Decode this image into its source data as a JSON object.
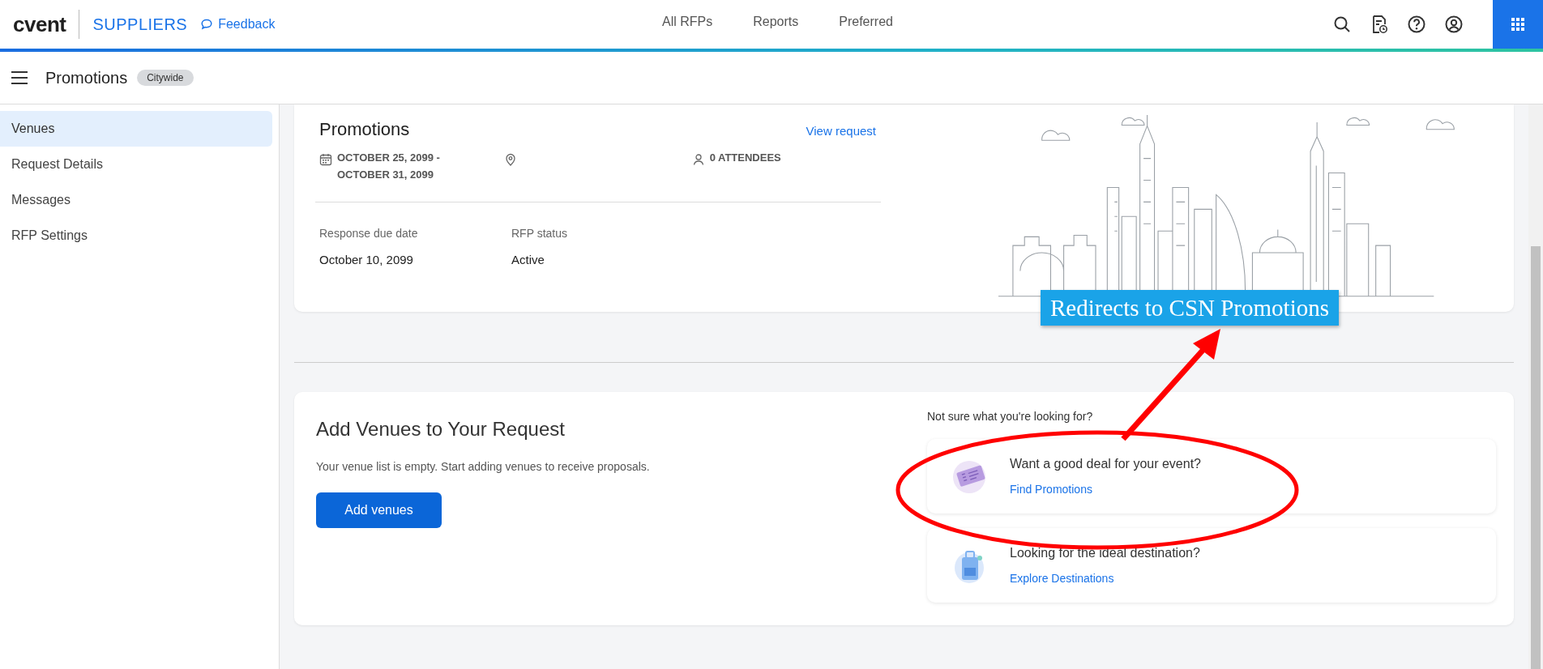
{
  "header": {
    "logo": "cvent",
    "product": "SUPPLIERS",
    "feedback": "Feedback",
    "nav": [
      {
        "label": "All RFPs",
        "selected": false
      },
      {
        "label": "Reports",
        "selected": false
      },
      {
        "label": "Preferred",
        "selected": false
      }
    ]
  },
  "subheader": {
    "title": "Promotions",
    "badge": "Citywide"
  },
  "sidebar": {
    "items": [
      {
        "label": "Venues",
        "selected": true
      },
      {
        "label": "Request Details",
        "selected": false
      },
      {
        "label": "Messages",
        "selected": false
      },
      {
        "label": "RFP Settings",
        "selected": false
      }
    ]
  },
  "summary": {
    "title": "Promotions",
    "link": "View request",
    "dates": [
      "OCTOBER 25, 2099 -",
      "OCTOBER 31, 2099"
    ],
    "attendees": "0 ATTENDEES",
    "fields": [
      {
        "label": "Response due date",
        "value": "October 10, 2099"
      },
      {
        "label": "RFP status",
        "value": "Active"
      }
    ]
  },
  "venues": {
    "title": "Add Venues to Your Request",
    "text": "Your venue list is empty. Start adding venues to receive proposals.",
    "button": "Add venues",
    "hint": "Not sure what you're looking for?",
    "suggestions": [
      {
        "kind": "ticket",
        "title": "Want a good deal for your event?",
        "link": "Find Promotions"
      },
      {
        "kind": "luggage",
        "title": "Looking for the ideal destination?",
        "link": "Explore Destinations"
      }
    ]
  },
  "annotation": {
    "label": "Redirects to CSN Promotions"
  }
}
